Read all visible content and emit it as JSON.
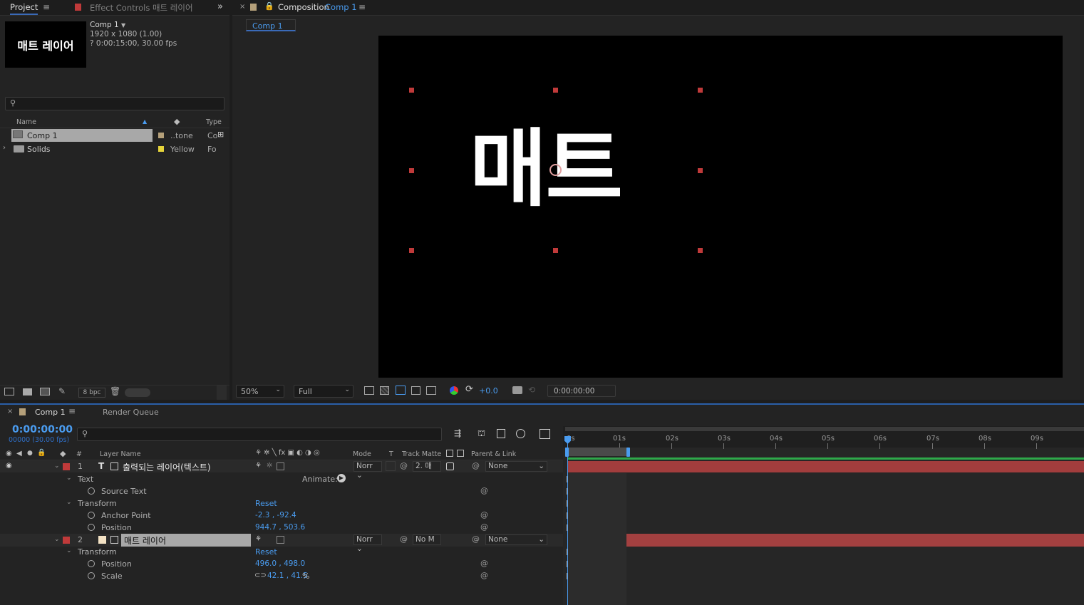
{
  "project_panel": {
    "tab_project": "Project",
    "tab_effect_controls": "Effect Controls 매트 레이어",
    "thumbnail_text": "매트 레이어",
    "comp_name": "Comp 1",
    "comp_resolution": "1920 x 1080 (1.00)",
    "comp_duration": "? 0:00:15:00, 30.00 fps",
    "search_placeholder": "",
    "col_name": "Name",
    "col_type": "Type",
    "items": [
      {
        "name": "Comp 1",
        "label_text": "..tone",
        "label_color": "#b5a07a",
        "type": "Co"
      },
      {
        "name": "Solids",
        "label_text": "Yellow",
        "label_color": "#e6d43a",
        "type": "Fo"
      }
    ],
    "bit_depth": "8 bpc"
  },
  "comp_panel": {
    "tab_title": "Composition",
    "tab_comp": "Comp 1",
    "subtab": "Comp 1",
    "viewer_text_main": "매트",
    "zoom": "50%",
    "resolution": "Full",
    "exposure": "+0.0",
    "timecode": "0:00:00:00"
  },
  "timeline": {
    "tab_comp": "Comp 1",
    "tab_render_queue": "Render Queue",
    "timecode": "0:00:00:00",
    "frame_info": "00000 (30.00 fps)",
    "col_num": "#",
    "col_layer_name": "Layer Name",
    "col_mode": "Mode",
    "col_t": "T",
    "col_track_matte": "Track Matte",
    "col_parent": "Parent & Link",
    "layer1": {
      "index": "1",
      "name": "출력되는 레이어(텍스트)",
      "mode": "Norr",
      "track_matte": "2. 매",
      "parent": "None",
      "text_group": "Text",
      "animate_label": "Animate:",
      "source_text": "Source Text",
      "transform_group": "Transform",
      "reset": "Reset",
      "anchor_point_label": "Anchor Point",
      "anchor_point_value": "-2.3 , -92.4",
      "position_label": "Position",
      "position_value": "944.7 , 503.6"
    },
    "layer2": {
      "index": "2",
      "name": "매트 레이어",
      "mode": "Norr",
      "track_matte": "No M",
      "parent": "None",
      "transform_group": "Transform",
      "reset": "Reset",
      "position_label": "Position",
      "position_value": "496.0 , 498.0",
      "scale_label": "Scale",
      "scale_value": "42.1 , 41.5",
      "scale_unit": "%"
    },
    "ruler_labels": [
      "0s",
      "01s",
      "02s",
      "03s",
      "04s",
      "05s",
      "06s",
      "07s",
      "08s",
      "09s"
    ],
    "colors": {
      "accent": "#4a9cf0",
      "layer_label_red": "#c03a3a",
      "layer_bar": "#a23d3d",
      "green_bar": "#2ea84a"
    }
  }
}
